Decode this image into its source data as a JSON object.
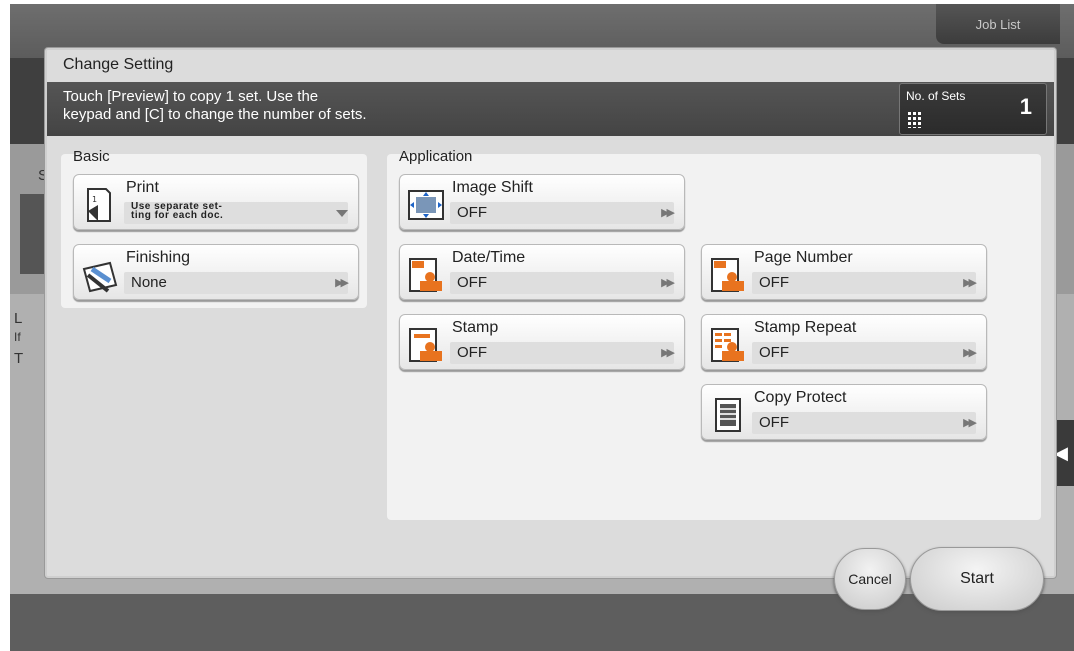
{
  "header": {
    "job_list": "Job List"
  },
  "background": {
    "letters": [
      "S",
      "L",
      "If",
      "T"
    ]
  },
  "dialog": {
    "title": "Change Setting",
    "message": "Touch [Preview] to copy 1 set. Use the\nkeypad and [C] to change the number of sets.",
    "sets": {
      "label": "No. of Sets",
      "value": "1"
    }
  },
  "basic": {
    "label": "Basic",
    "print": {
      "title": "Print",
      "value": "Use separate set-\nting for each doc."
    },
    "finishing": {
      "title": "Finishing",
      "value": "None"
    }
  },
  "application": {
    "label": "Application",
    "image_shift": {
      "title": "Image Shift",
      "value": "OFF"
    },
    "date_time": {
      "title": "Date/Time",
      "value": "OFF"
    },
    "page_number": {
      "title": "Page Number",
      "value": "OFF"
    },
    "stamp": {
      "title": "Stamp",
      "value": "OFF"
    },
    "stamp_repeat": {
      "title": "Stamp Repeat",
      "value": "OFF"
    },
    "copy_protect": {
      "title": "Copy Protect",
      "value": "OFF"
    }
  },
  "footer": {
    "cancel": "Cancel",
    "start": "Start"
  },
  "icons": {
    "side_handle": "arrow-left-icon",
    "arrow_glyph": "▶▶",
    "handle_glyph": "◀"
  },
  "colors": {
    "accent": "#e8731f",
    "blue": "#1e64c8"
  }
}
